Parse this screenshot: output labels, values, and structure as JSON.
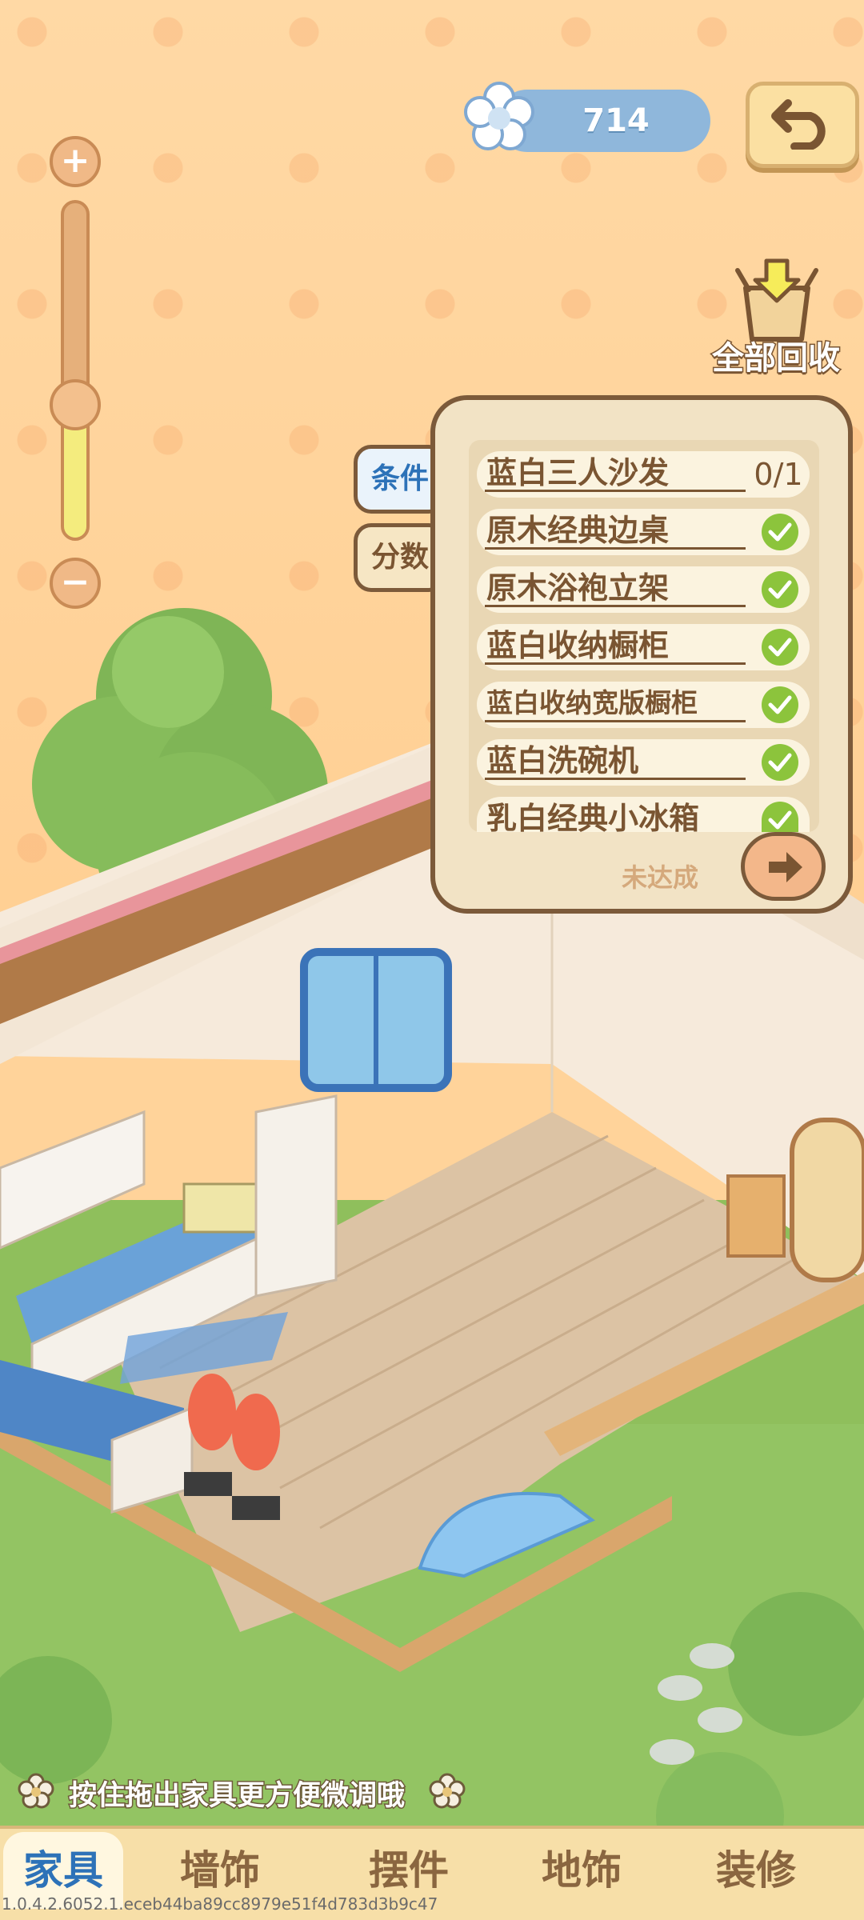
{
  "currency": {
    "value": "714",
    "icon": "flower-icon"
  },
  "zoom": {
    "level": 0.4
  },
  "recycle": {
    "label": "全部回收"
  },
  "side_tabs": [
    {
      "label": "条件",
      "active": true
    },
    {
      "label": "分数",
      "active": false
    }
  ],
  "conditions": {
    "items": [
      {
        "label": "蓝白三人沙发",
        "count": "0/1",
        "done": false
      },
      {
        "label": "原木经典边桌",
        "done": true
      },
      {
        "label": "原木浴袍立架",
        "done": true
      },
      {
        "label": "蓝白收纳橱柜",
        "done": true
      },
      {
        "label": "蓝白收纳宽版橱柜",
        "done": true
      },
      {
        "label": "蓝白洗碗机",
        "done": true
      },
      {
        "label": "乳白经典小冰箱",
        "done": true
      }
    ],
    "status": "未达成"
  },
  "hint": "按住拖出家具更方便微调哦",
  "bottom_nav": [
    {
      "label": "家具",
      "active": true
    },
    {
      "label": "墙饰",
      "active": false
    },
    {
      "label": "摆件",
      "active": false
    },
    {
      "label": "地饰",
      "active": false
    },
    {
      "label": "装修",
      "active": false
    }
  ],
  "version": "1.0.4.2.6052.1.eceb44ba89cc8979e51f4d783d3b9c47",
  "colors": {
    "accent_blue": "#2d72b8",
    "brown": "#7a5532",
    "check_green": "#8cc43c",
    "pill_blue": "#8fb7db"
  }
}
